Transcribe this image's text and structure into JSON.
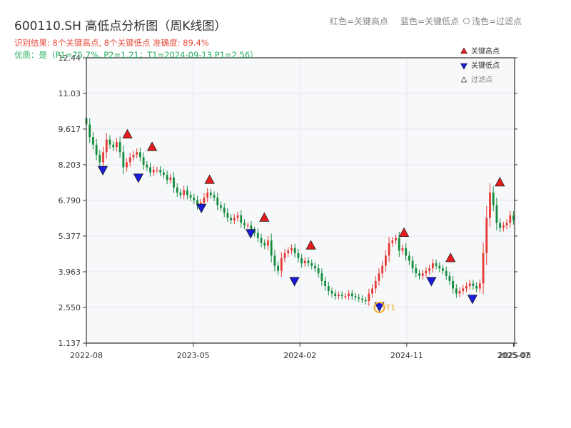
{
  "header": {
    "title": "600110.SH 高低点分析图（周K线图）",
    "hint_high": "红色=关键高点",
    "hint_low": "蓝色=关键低点",
    "hint_filter": "浅色=过滤点",
    "result_line": "识别结果: 8个关键高点, 8个关键低点  准确度: 89.4%",
    "quality_line": "优质：是（P1=75.7%, P2=1.21；T1=2024-09-13 P1=2.56）"
  },
  "colors": {
    "up": "#e53935",
    "down": "#128c3c",
    "high_marker": "#e81c1c",
    "low_marker": "#1a1adb",
    "t1_ring": "#f5a623",
    "result_text": "#e74c3c",
    "quality_text": "#27ae60",
    "plot_bg": "#f7f8fa",
    "grid": "#e3e6ea"
  },
  "chart_data": {
    "type": "candlestick",
    "period": "weekly",
    "y_ticks": [
      "1.137",
      "2.550",
      "3.963",
      "5.377",
      "6.790",
      "8.203",
      "9.617",
      "11.03",
      "12.44"
    ],
    "ylim": [
      1.137,
      12.44
    ],
    "x_ticks": [
      {
        "label": "2022-08",
        "t": 0
      },
      {
        "label": "2023-05",
        "t": 39
      },
      {
        "label": "2024-02",
        "t": 78
      },
      {
        "label": "2024-11",
        "t": 117
      },
      {
        "label": "2025-07",
        "t": 156
      },
      {
        "label": "2025-08",
        "t": 156.4
      }
    ],
    "legend": {
      "position": "top-right",
      "entries": [
        "关键高点",
        "关键低点",
        "过滤点"
      ]
    },
    "close_series": [
      9.8,
      9.3,
      9.0,
      8.6,
      8.3,
      8.7,
      9.2,
      9.0,
      8.9,
      9.1,
      8.7,
      8.1,
      8.3,
      8.5,
      8.6,
      8.7,
      8.5,
      8.2,
      8.1,
      7.9,
      8.0,
      8.0,
      7.9,
      7.8,
      7.6,
      7.7,
      7.3,
      7.1,
      7.0,
      7.2,
      7.0,
      6.9,
      6.8,
      6.6,
      6.7,
      6.9,
      7.1,
      7.0,
      6.9,
      6.6,
      6.5,
      6.3,
      6.1,
      6.0,
      6.1,
      6.2,
      5.9,
      5.8,
      5.8,
      5.6,
      5.5,
      5.3,
      5.1,
      5.0,
      5.2,
      4.6,
      4.2,
      4.0,
      4.5,
      4.7,
      4.8,
      4.9,
      4.7,
      4.5,
      4.3,
      4.4,
      4.3,
      4.2,
      4.1,
      3.9,
      3.6,
      3.4,
      3.2,
      3.1,
      3.0,
      3.05,
      3.0,
      3.0,
      3.1,
      3.0,
      2.95,
      2.9,
      2.85,
      2.8,
      3.1,
      3.3,
      3.6,
      3.9,
      4.2,
      4.6,
      5.1,
      5.2,
      5.3,
      4.8,
      4.9,
      4.6,
      4.4,
      4.1,
      3.9,
      3.8,
      3.9,
      4.0,
      4.1,
      4.3,
      4.2,
      4.1,
      4.0,
      3.8,
      3.6,
      3.3,
      3.1,
      3.2,
      3.3,
      3.4,
      3.5,
      3.4,
      3.3,
      3.5,
      4.7,
      6.1,
      7.1,
      6.6,
      5.9,
      5.7,
      5.8,
      5.9,
      6.2,
      6.0
    ],
    "key_highs": [
      {
        "t": 15,
        "v": 9.4
      },
      {
        "t": 24,
        "v": 8.9
      },
      {
        "t": 45,
        "v": 7.6
      },
      {
        "t": 65,
        "v": 6.1
      },
      {
        "t": 82,
        "v": 5.0
      },
      {
        "t": 116,
        "v": 5.5
      },
      {
        "t": 133,
        "v": 4.5
      },
      {
        "t": 151,
        "v": 7.5
      }
    ],
    "key_lows": [
      {
        "t": 6,
        "v": 8.0
      },
      {
        "t": 19,
        "v": 7.7
      },
      {
        "t": 42,
        "v": 6.5
      },
      {
        "t": 60,
        "v": 5.5
      },
      {
        "t": 76,
        "v": 3.6
      },
      {
        "t": 107,
        "v": 2.6
      },
      {
        "t": 126,
        "v": 3.6
      },
      {
        "t": 141,
        "v": 2.9
      }
    ],
    "t1_marker": {
      "label": "T1",
      "t": 107,
      "v": 2.55
    }
  }
}
